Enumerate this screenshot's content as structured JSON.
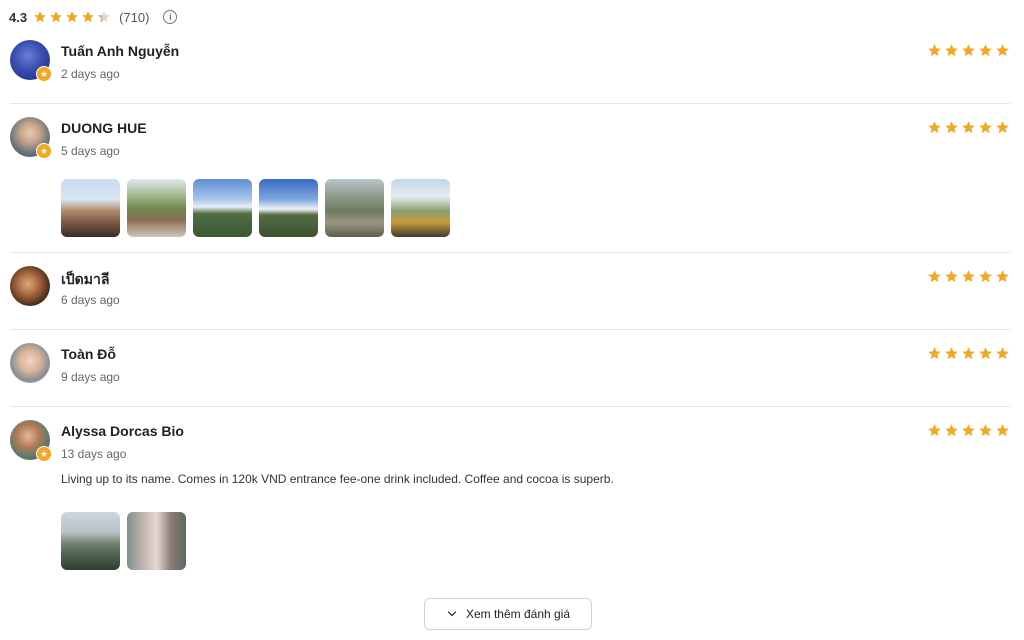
{
  "summary": {
    "score": "4.3",
    "count": "(710)",
    "info_symbol": "i"
  },
  "colors": {
    "star": "#f5a623",
    "divider": "#e6e6e6"
  },
  "reviews": [
    {
      "name": "Tuấn Anh Nguyễn",
      "time": "2 days ago",
      "rating": 5,
      "text": "",
      "photo_count": 0,
      "local_guide": true
    },
    {
      "name": "DUONG HUE",
      "time": "5 days ago",
      "rating": 5,
      "text": "",
      "photo_count": 6,
      "local_guide": true
    },
    {
      "name": "เป็ดมาลี",
      "time": "6 days ago",
      "rating": 5,
      "text": "",
      "photo_count": 0,
      "local_guide": false
    },
    {
      "name": "Toàn Đỗ",
      "time": "9 days ago",
      "rating": 5,
      "text": "",
      "photo_count": 0,
      "local_guide": false
    },
    {
      "name": "Alyssa Dorcas Bio",
      "time": "13 days ago",
      "rating": 5,
      "text": "Living up to its name. Comes in 120k VND entrance fee-one drink included. Coffee and cocoa is superb.",
      "photo_count": 2,
      "local_guide": true
    }
  ],
  "more_button": {
    "label": "Xem thêm đánh giá",
    "icon": "chevron-down-icon"
  }
}
